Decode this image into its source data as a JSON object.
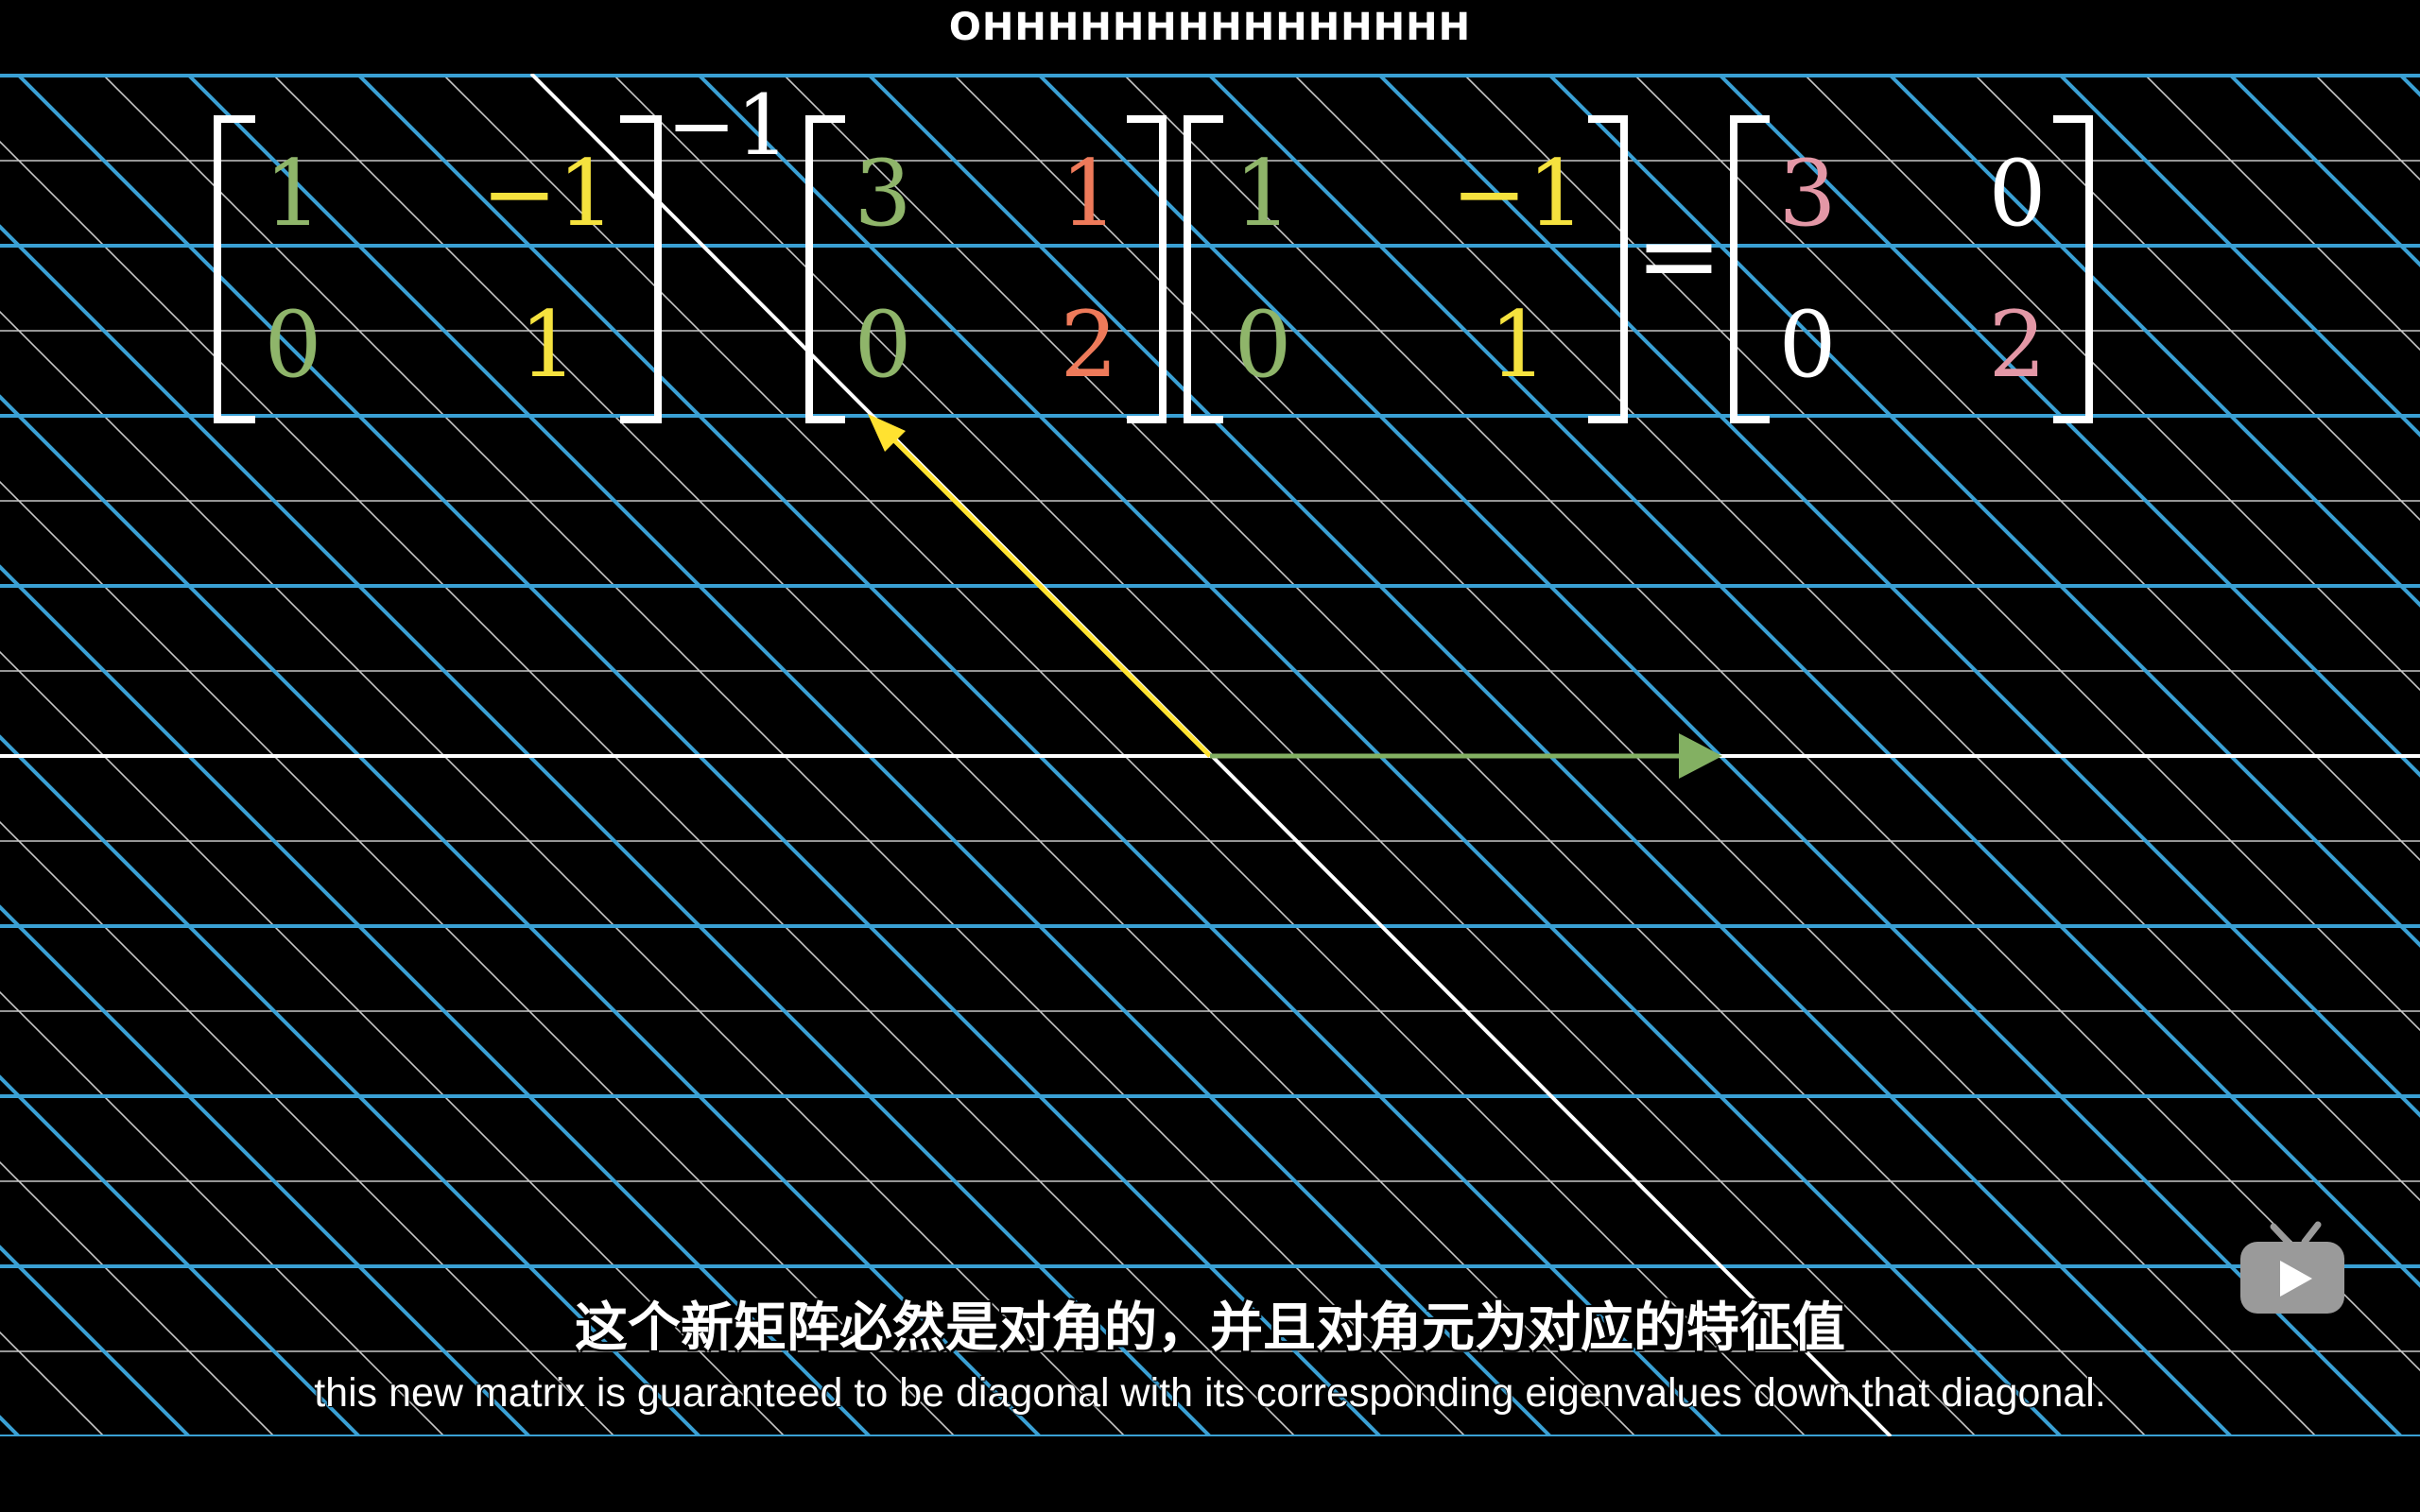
{
  "danmaku": {
    "text": "OHHHHHHHHHHHHHHH"
  },
  "equation": {
    "inverse_exponent": "−1",
    "equals": "=",
    "matrix_a": {
      "a11": "1",
      "a12": "−1",
      "a21": "0",
      "a22": "1"
    },
    "matrix_b": {
      "b11": "3",
      "b12": "1",
      "b21": "0",
      "b22": "2"
    },
    "matrix_c": {
      "c11": "1",
      "c12": "−1",
      "c21": "0",
      "c22": "1"
    },
    "matrix_d": {
      "d11": "3",
      "d12": "0",
      "d21": "0",
      "d22": "2"
    }
  },
  "colors": {
    "green": "#8fb56a",
    "yellow": "#f5e23e",
    "red": "#ee7a5a",
    "pink": "#e397a6",
    "white": "#ffffff",
    "grid_blue": "#3aa0d4",
    "grid_gray": "#c8c8c8",
    "vector_yellow": "#ffe230",
    "vector_green": "#83b062"
  },
  "subtitles": {
    "chinese": "这个新矩阵必然是对角的，并且对角元为对应的特征值",
    "english": "this new matrix is guaranteed to be diagonal with its corresponding eigenvalues down that diagonal."
  },
  "player": {
    "tv_icon": "tv-icon"
  }
}
